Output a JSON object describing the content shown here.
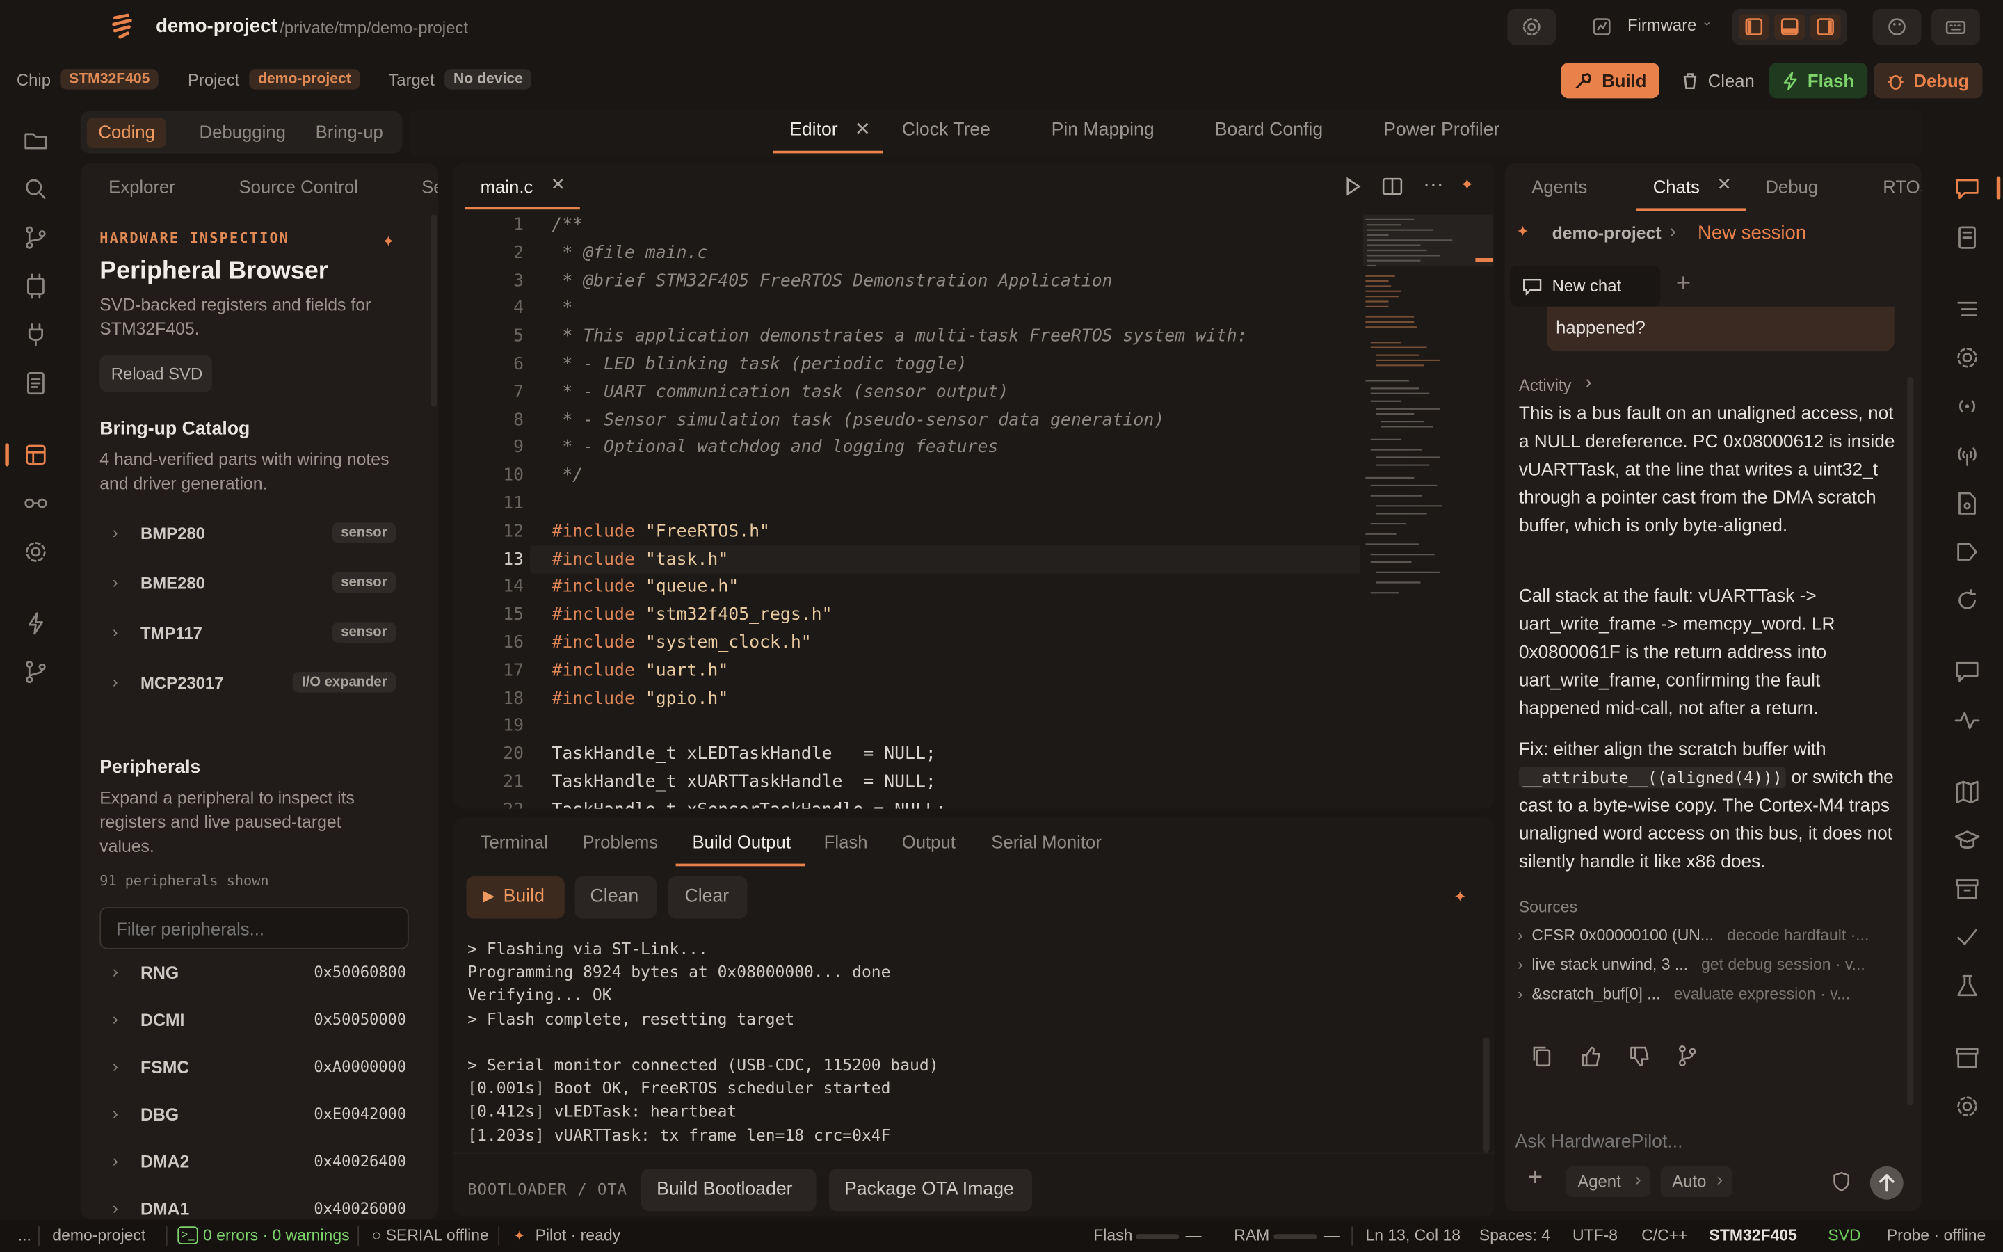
{
  "header": {
    "project_name": "demo-project",
    "project_path": "/private/tmp/demo-project",
    "mode_select": "Firmware"
  },
  "chipbar": {
    "chip_label": "Chip",
    "chip_value": "STM32F405",
    "project_label": "Project",
    "project_value": "demo-project",
    "target_label": "Target",
    "target_value": "No device"
  },
  "actions": {
    "build": "Build",
    "clean": "Clean",
    "flash": "Flash",
    "debug": "Debug"
  },
  "mode_tabs": [
    "Coding",
    "Debugging",
    "Bring-up"
  ],
  "center_tabs": [
    "Editor",
    "Clock Tree",
    "Pin Mapping",
    "Board Config",
    "Power Profiler"
  ],
  "sidebar": {
    "tabs": [
      "Explorer",
      "Source Control",
      "Se"
    ],
    "eyebrow": "HARDWARE INSPECTION",
    "title": "Peripheral Browser",
    "subtitle": "SVD-backed registers and fields for STM32F405.",
    "reload_button": "Reload SVD",
    "catalog_title": "Bring-up Catalog",
    "catalog_desc": "4 hand-verified parts with wiring notes and driver generation.",
    "catalog": [
      {
        "name": "BMP280",
        "tag": "sensor"
      },
      {
        "name": "BME280",
        "tag": "sensor"
      },
      {
        "name": "TMP117",
        "tag": "sensor"
      },
      {
        "name": "MCP23017",
        "tag": "I/O expander"
      }
    ],
    "peripherals_title": "Peripherals",
    "peripherals_desc": "Expand a peripheral to inspect its registers and live paused-target values.",
    "peripherals_count": "91 peripherals shown",
    "filter_placeholder": "Filter peripherals...",
    "peripherals": [
      {
        "name": "RNG",
        "addr": "0x50060800"
      },
      {
        "name": "DCMI",
        "addr": "0x50050000"
      },
      {
        "name": "FSMC",
        "addr": "0xA0000000"
      },
      {
        "name": "DBG",
        "addr": "0xE0042000"
      },
      {
        "name": "DMA2",
        "addr": "0x40026400"
      },
      {
        "name": "DMA1",
        "addr": "0x40026000"
      }
    ]
  },
  "editor": {
    "file_tab": "main.c",
    "lines": [
      "/**",
      " * @file main.c",
      " * @brief STM32F405 FreeRTOS Demonstration Application",
      " *",
      " * This application demonstrates a multi-task FreeRTOS system with:",
      " * - LED blinking task (periodic toggle)",
      " * - UART communication task (sensor output)",
      " * - Sensor simulation task (pseudo-sensor data generation)",
      " * - Optional watchdog and logging features",
      " */",
      "",
      "#include \"FreeRTOS.h\"",
      "#include \"task.h\"",
      "#include \"queue.h\"",
      "#include \"stm32f405_regs.h\"",
      "#include \"system_clock.h\"",
      "#include \"uart.h\"",
      "#include \"gpio.h\"",
      "",
      "TaskHandle_t xLEDTaskHandle   = NULL;",
      "TaskHandle_t xUARTTaskHandle  = NULL;",
      "TaskHandle_t xSensorTaskHandle = NULL;"
    ]
  },
  "bottom": {
    "tabs": [
      "Terminal",
      "Problems",
      "Build Output",
      "Flash",
      "Output",
      "Serial Monitor"
    ],
    "build_button": "Build",
    "clean_button": "Clean",
    "clear_button": "Clear",
    "output": [
      "> Flashing via ST-Link...",
      "Programming 8924 bytes at 0x08000000... done",
      "Verifying... OK",
      "> Flash complete, resetting target",
      "",
      "> Serial monitor connected (USB-CDC, 115200 baud)",
      "[0.001s] Boot OK, FreeRTOS scheduler started",
      "[0.412s] vLEDTask: heartbeat",
      "[1.203s] vUARTTask: tx frame len=18 crc=0x4F"
    ],
    "bootloader_label": "BOOTLOADER / OTA",
    "build_bootloader": "Build Bootloader",
    "package_ota": "Package OTA Image"
  },
  "chat": {
    "tabs": [
      "Agents",
      "Chats",
      "Debug",
      "RTOS"
    ],
    "breadcrumb_project": "demo-project",
    "breadcrumb_session": "New session",
    "new_chat": "New chat",
    "user_msg_tail": "happened?",
    "activity_label": "Activity",
    "p1": "This is a bus fault on an unaligned access, not a NULL dereference. PC 0x08000612 is inside vUARTTask, at the line that writes a uint32_t through a pointer cast from the DMA scratch buffer, which is only byte-aligned.",
    "p2": "Call stack at the fault: vUARTTask -> uart_write_frame -> memcpy_word. LR 0x0800061F is the return address into uart_write_frame, confirming the fault happened mid-call, not after a return.",
    "p3a": "Fix: either align the scratch buffer with ",
    "p3code": "__attribute__((aligned(4)))",
    "p3b": " or switch the cast to a byte-wise copy. The Cortex-M4 traps unaligned word access on this bus, it does not silently handle it like x86 does.",
    "sources_label": "Sources",
    "sources": [
      {
        "title": "CFSR 0x00000100 (UN...",
        "detail": "decode hardfault ·..."
      },
      {
        "title": "live stack unwind, 3 ...",
        "detail": "get debug session · v..."
      },
      {
        "title": "&scratch_buf[0] ...",
        "detail": "evaluate expression · v..."
      }
    ],
    "input_placeholder": "Ask HardwarePilot...",
    "agent_select": "Agent",
    "auto_select": "Auto"
  },
  "status": {
    "dots": "...",
    "project": "demo-project",
    "problems": "0 errors · 0 warnings",
    "serial": "○ SERIAL offline",
    "pilot": "Pilot · ready",
    "flash": "Flash",
    "flash_val": "—",
    "ram": "RAM",
    "ram_val": "—",
    "cursor": "Ln 13, Col 18",
    "spaces": "Spaces: 4",
    "encoding": "UTF-8",
    "language": "C/C++",
    "chip": "STM32F405",
    "svd": "SVD",
    "probe": "Probe · offline"
  },
  "colors": {
    "accent": "#e8814a",
    "flash_green": "#7ed36a",
    "svd_green": "#6fcf5a"
  }
}
